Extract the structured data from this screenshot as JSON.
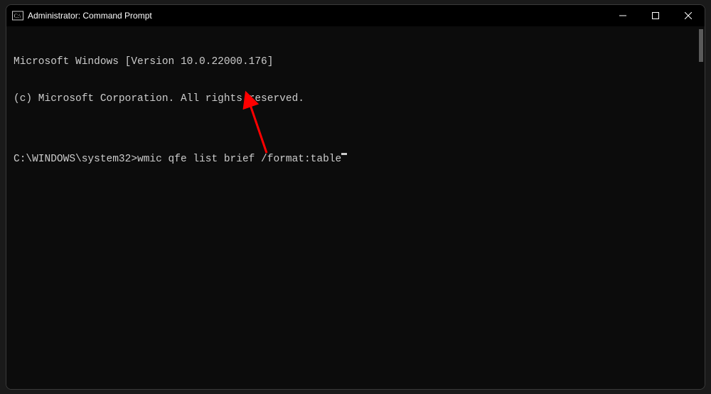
{
  "window": {
    "title": "Administrator: Command Prompt"
  },
  "terminal": {
    "line1": "Microsoft Windows [Version 10.0.22000.176]",
    "line2": "(c) Microsoft Corporation. All rights reserved.",
    "blank": "",
    "prompt": "C:\\WINDOWS\\system32>",
    "command": "wmic qfe list brief /format:table"
  },
  "annotation": {
    "color": "#ff0000"
  }
}
